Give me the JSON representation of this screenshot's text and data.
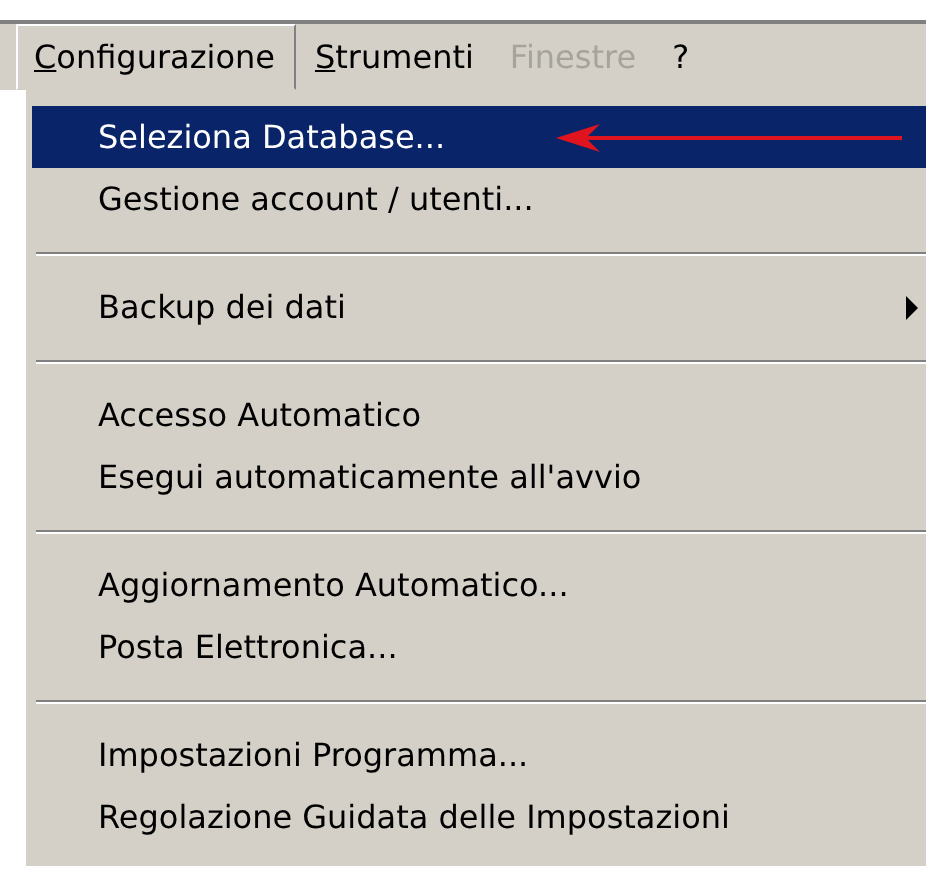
{
  "menu_bar": [
    {
      "label": "Configurazione",
      "underline_first": true,
      "open": true,
      "disabled": false
    },
    {
      "label": "Strumenti",
      "underline_first": true,
      "open": false,
      "disabled": false
    },
    {
      "label": "Finestre",
      "underline_first": false,
      "open": false,
      "disabled": true
    },
    {
      "label": "?",
      "underline_first": false,
      "open": false,
      "disabled": false
    }
  ],
  "dropdown": [
    {
      "kind": "item",
      "label": "Seleziona Database...",
      "selected": true,
      "submenu": false,
      "pointed": true
    },
    {
      "kind": "item",
      "label": "Gestione account / utenti...",
      "selected": false,
      "submenu": false,
      "pointed": false
    },
    {
      "kind": "separator"
    },
    {
      "kind": "item",
      "label": "Backup dei dati",
      "selected": false,
      "submenu": true,
      "pointed": false
    },
    {
      "kind": "separator"
    },
    {
      "kind": "item",
      "label": "Accesso Automatico",
      "selected": false,
      "submenu": false,
      "pointed": false
    },
    {
      "kind": "item",
      "label": "Esegui automaticamente all'avvio",
      "selected": false,
      "submenu": false,
      "pointed": false
    },
    {
      "kind": "separator"
    },
    {
      "kind": "item",
      "label": "Aggiornamento Automatico...",
      "selected": false,
      "submenu": false,
      "pointed": false
    },
    {
      "kind": "item",
      "label": "Posta Elettronica...",
      "selected": false,
      "submenu": false,
      "pointed": false
    },
    {
      "kind": "separator"
    },
    {
      "kind": "item",
      "label": "Impostazioni Programma...",
      "selected": false,
      "submenu": false,
      "pointed": false
    },
    {
      "kind": "item",
      "label": "Regolazione Guidata delle Impostazioni",
      "selected": false,
      "submenu": false,
      "pointed": false
    }
  ]
}
